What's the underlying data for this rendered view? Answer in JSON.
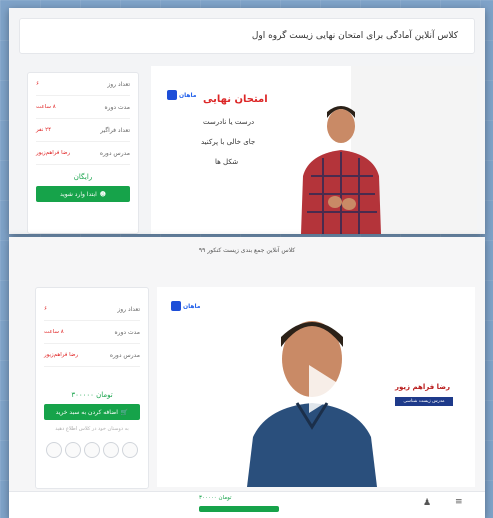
{
  "screen1": {
    "title": "کلاس آنلاین آمادگی برای امتحان نهایی زیست گروه اول",
    "rows": [
      {
        "label": "تعداد روز",
        "value": "۶"
      },
      {
        "label": "مدت دوره",
        "value": "۸ ساعت"
      },
      {
        "label": "تعداد فراگیر",
        "value": "۲۴ نفر"
      },
      {
        "label": "مدرس دوره",
        "value": "رضا فراهم‌زیور"
      }
    ],
    "price": "رایگان",
    "buy_label": "ابتدا وارد شوید",
    "slide": {
      "logo": "ماهان",
      "title": "امتحان نهایی",
      "lines": [
        "درست یا نادرست",
        "جای خالی با پرکنید",
        "شکل ها"
      ]
    }
  },
  "screen2": {
    "title": "کلاس آنلاین جمع بندی زیست کنکور ۹۹",
    "rows": [
      {
        "label": "تعداد روز",
        "value": "۶"
      },
      {
        "label": "مدت دوره",
        "value": "۸ ساعت"
      },
      {
        "label": "مدرس دوره",
        "value": "رضا فراهم‌زیور"
      }
    ],
    "price": "تومان ۳۰۰۰۰۰",
    "buy_label": "اضافه کردن به سبد خرید",
    "share_text": "به دوستان خود در کلاس اطلاع دهید",
    "logo": "ماهان",
    "banner_name": "رضا فراهم زیور",
    "banner_sub": "مدرس زیست شناسی",
    "bottom_price": "تومان ۳۰۰۰۰۰"
  }
}
